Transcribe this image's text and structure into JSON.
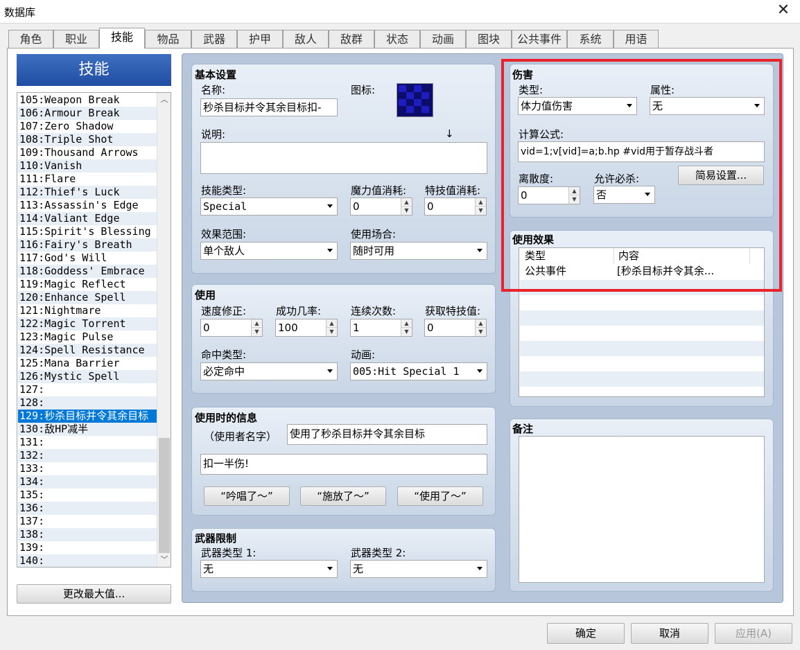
{
  "window": {
    "title": "数据库",
    "close_glyph": "✕"
  },
  "tabs": [
    "角色",
    "职业",
    "技能",
    "物品",
    "武器",
    "护甲",
    "敌人",
    "敌群",
    "状态",
    "动画",
    "图块",
    "公共事件",
    "系统",
    "用语"
  ],
  "active_tab": "技能",
  "left_panel": {
    "header": "技能",
    "items": [
      "105:Weapon Break",
      "106:Armour Break",
      "107:Zero Shadow",
      "108:Triple Shot",
      "109:Thousand Arrows",
      "110:Vanish",
      "111:Flare",
      "112:Thief's Luck",
      "113:Assassin's Edge",
      "114:Valiant Edge",
      "115:Spirit's Blessing",
      "116:Fairy's Breath",
      "117:God's Will",
      "118:Goddess' Embrace",
      "119:Magic Reflect",
      "120:Enhance Spell",
      "121:Nightmare",
      "122:Magic Torrent",
      "123:Magic Pulse",
      "124:Spell Resistance",
      "125:Mana Barrier",
      "126:Mystic Spell",
      "127:",
      "128:",
      "129:秒杀目标并令其余目标",
      "130:敌HP减半",
      "131:",
      "132:",
      "133:",
      "134:",
      "135:",
      "136:",
      "137:",
      "138:",
      "139:",
      "140:"
    ],
    "selected_item": "129:秒杀目标并令其余目标",
    "change_max_button": "更改最大值..."
  },
  "basic": {
    "title": "基本设置",
    "name_label": "名称:",
    "name_value": "秒杀目标并令其余目标扣-",
    "icon_label": "图标:",
    "desc_label": "说明:",
    "desc_value": "",
    "cursor_glyph": "↓",
    "skill_type_label": "技能类型:",
    "skill_type_value": "Special",
    "mp_cost_label": "魔力值消耗:",
    "mp_cost_value": "0",
    "tp_cost_label": "特技值消耗:",
    "tp_cost_value": "0",
    "scope_label": "效果范围:",
    "scope_value": "单个敌人",
    "occasion_label": "使用场合:",
    "occasion_value": "随时可用"
  },
  "invocation": {
    "title": "使用",
    "speed_label": "速度修正:",
    "speed_value": "0",
    "success_label": "成功几率:",
    "success_value": "100",
    "repeat_label": "连续次数:",
    "repeat_value": "1",
    "tp_gain_label": "获取特技值:",
    "tp_gain_value": "0",
    "hit_type_label": "命中类型:",
    "hit_type_value": "必定命中",
    "animation_label": "动画:",
    "animation_value": "005:Hit Special 1"
  },
  "message": {
    "title": "使用时的信息",
    "user_name_label": "（使用者名字）",
    "line1": "使用了秒杀目标并令其余目标",
    "line2": "扣一半伤!",
    "btn_chant": "“吟唱了～”",
    "btn_cast": "“施放了～”",
    "btn_use": "“使用了～”"
  },
  "weapon_req": {
    "title": "武器限制",
    "type1_label": "武器类型 1:",
    "type1_value": "无",
    "type2_label": "武器类型 2:",
    "type2_value": "无"
  },
  "damage": {
    "title": "伤害",
    "type_label": "类型:",
    "type_value": "体力值伤害",
    "element_label": "属性:",
    "element_value": "无",
    "formula_label": "计算公式:",
    "formula_value": "vid=1;v[vid]=a;b.hp #vid用于暂存战斗者",
    "variance_label": "离散度:",
    "variance_value": "0",
    "critical_label": "允许必杀:",
    "critical_value": "否",
    "easy_setup_button": "简易设置..."
  },
  "effects": {
    "title": "使用效果",
    "col_type": "类型",
    "col_content": "内容",
    "rows": [
      {
        "type": "公共事件",
        "content": "[秒杀目标并令其余..."
      }
    ]
  },
  "notes": {
    "title": "备注",
    "value": ""
  },
  "footer": {
    "ok": "确定",
    "cancel": "取消",
    "apply": "应用(A)"
  },
  "colors": {
    "highlight": "#e8232a",
    "selection": "#0078d7",
    "header_blue": "#2a58ad"
  }
}
